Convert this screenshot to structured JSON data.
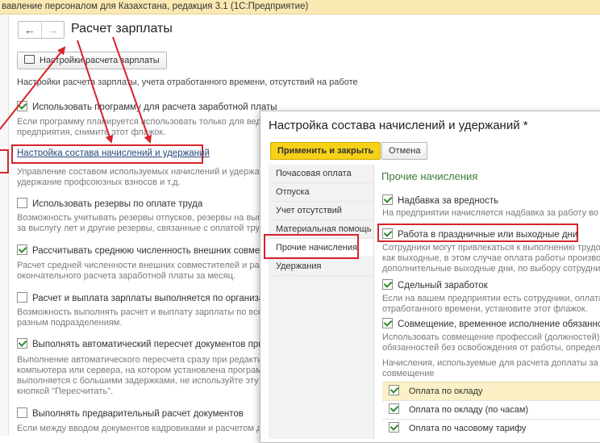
{
  "window": {
    "title": "вавление персоналом для Казахстана, редакция 3.1  (1С:Предприятие)"
  },
  "nav": {
    "back": "←",
    "forward": "→"
  },
  "page": {
    "title": "Расчет зарплаты",
    "settings_button": "Настройки расчета зарплаты",
    "subtitle": "Настройки расчета зарплаты, учета отработанного времени, отсутствий на работе"
  },
  "options": [
    {
      "label": "Использовать программу для расчета заработной платы",
      "checked": true,
      "desc1": "Если программу планируется использовать только для веден",
      "desc2": "предприятия, снимите этот флажок."
    },
    {
      "link": "Настройка состава начислений и удержаний",
      "desc1": "Управление составом используемых начислений и удержани",
      "desc2": "удержание профсоюзных взносов и т.д."
    },
    {
      "label": "Использовать резервы по оплате труда",
      "checked": false,
      "desc1": "Возможность учитывать резервы отпусков,  резервы на выпла",
      "desc2": "за выслугу лет и другие резервы, связанные с оплатой труда."
    },
    {
      "label": "Рассчитывать среднюю численность внешних совместите",
      "checked": true,
      "desc1": "Расчет средней численности внешних совместителей и работ",
      "desc2": "окончательного расчета заработной платы за месяц."
    },
    {
      "label": "Расчет и выплата зарплаты выполняется по организации в",
      "checked": false,
      "desc1": "Возможность выполнять расчет и выплату зарплаты по всей о",
      "desc2": "разным подразделениям."
    },
    {
      "label": "Выполнять автоматический пересчет документов при их р",
      "checked": true,
      "desc1": "Выполнение автоматического пересчета сразу при редактиро",
      "desc2": "компьютера или сервера, на котором установлена программа",
      "desc3": "выполняется с большими задержками, не используйте эту воз",
      "desc4": "кнопкой \"Пересчитать\"."
    },
    {
      "label": "Выполнять предварительный расчет документов",
      "checked": false,
      "desc1": "Если между вводом документов кадровиками и расчетом доку"
    }
  ],
  "dialog": {
    "title": "Настройка состава начислений и удержаний *",
    "apply_button": "Применить и закрыть",
    "cancel_button": "Отмена",
    "tabs": [
      "Почасовая оплата",
      "Отпуска",
      "Учет отсутствий",
      "Материальная помощь",
      "Прочие начисления",
      "Удержания"
    ],
    "selected_tab": "Прочие начисления",
    "section_title": "Прочие начисления",
    "items": [
      {
        "label": "Надбавка за вредность",
        "checked": true,
        "desc1": "На предприятии начисляется надбавка за работу во вре"
      },
      {
        "label": "Работа в праздничные или выходные дни",
        "checked": true,
        "desc1": "Сотрудники могут привлекаться к выполнению трудовых",
        "desc2": "как выходные, в этом случае оплата работы производит",
        "desc3": "дополнительные выходные дни, по выбору сотрудника."
      },
      {
        "label": "Сдельный заработок",
        "checked": true,
        "desc1": "Если на вашем предприятии есть сотрудники, оплата тр",
        "desc2": "отработанного времени, установите этот флажок."
      },
      {
        "label": "Совмещение, временное исполнение обязанностей",
        "checked": true,
        "desc1": "Использовать совмещение профессий (должностей), ра",
        "desc2": "обязанностей без освобождения от работы, определен"
      }
    ],
    "accruals_label1": "Начисления, используемые для расчета доплаты за",
    "accruals_label2": "совмещение",
    "accruals": [
      {
        "label": "Оплата по окладу",
        "checked": true
      },
      {
        "label": "Оплата по окладу (по часам)",
        "checked": true
      },
      {
        "label": "Оплата по часовому тарифу",
        "checked": true
      }
    ]
  },
  "colors": {
    "accent_red": "#d8232a",
    "apply_yellow": "#f7d117",
    "section_green": "#3a7d3a",
    "check_green": "#2d8a2d"
  }
}
